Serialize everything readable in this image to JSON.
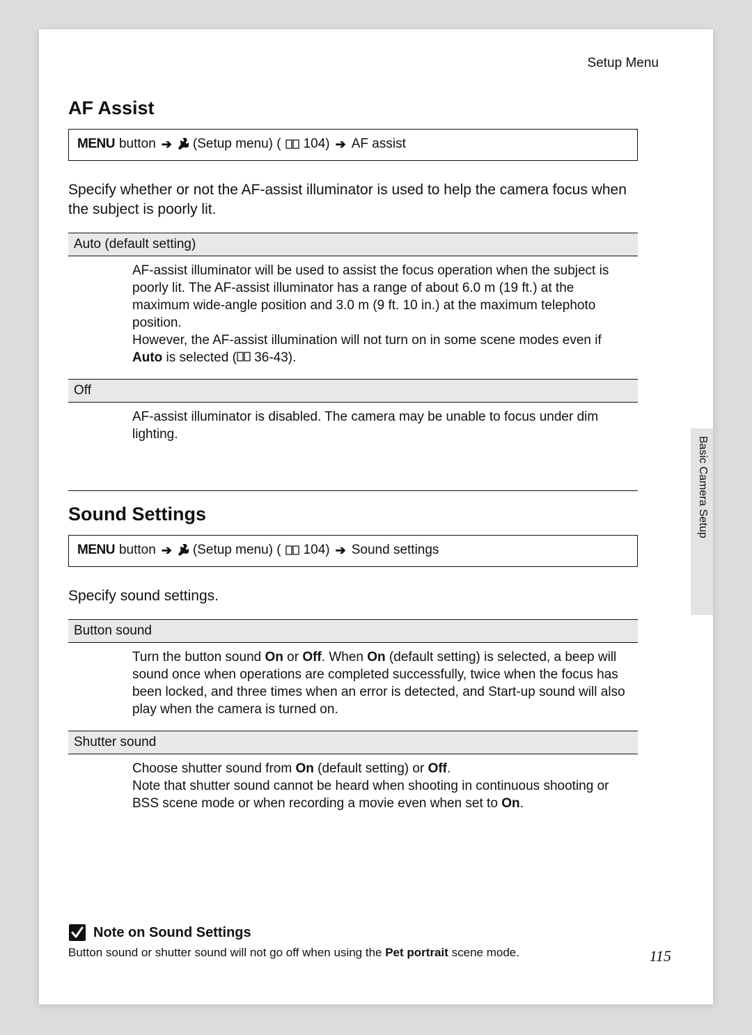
{
  "running_head": "Setup Menu",
  "side_tab_label": "Basic Camera Setup",
  "page_number": "115",
  "nav": {
    "menu_label": "MENU",
    "button_word": " button",
    "setup_menu_text": " (Setup menu) (",
    "page_ref_104": " 104)",
    "page_ref_36_43": " 36-43)."
  },
  "af": {
    "title": "AF Assist",
    "breadcrumb_end": " AF assist",
    "intro": "Specify whether or not the AF-assist illuminator is used to help the camera focus when the subject is poorly lit.",
    "opt_auto_header": "Auto (default setting)",
    "opt_auto_body_1": "AF-assist illuminator will be used to assist the focus operation when the subject is poorly lit. The AF-assist illuminator has a range of about 6.0 m (19 ft.) at the maximum wide-angle position and 3.0 m (9 ft. 10 in.) at the maximum telephoto position.",
    "opt_auto_body_2a": "However, the AF-assist illumination will not turn on in some scene modes even if ",
    "opt_auto_body_2b": "Auto",
    "opt_auto_body_2c": " is selected (",
    "opt_off_header": "Off",
    "opt_off_body": "AF-assist illuminator is disabled. The camera may be unable to focus under dim lighting."
  },
  "sound": {
    "title": "Sound Settings",
    "breadcrumb_end": " Sound settings",
    "intro": "Specify sound settings.",
    "opt_button_header": "Button sound",
    "bs_1": "Turn the button sound ",
    "bs_on": "On",
    "bs_2": " or ",
    "bs_off": "Off",
    "bs_3": ". When ",
    "bs_4": " (default setting) is selected, a beep will sound once when operations are completed successfully, twice when the focus has been locked, and three times when an error is detected, and Start-up sound will also play when the camera is turned on.",
    "opt_shutter_header": "Shutter sound",
    "sh_1": "Choose shutter sound from ",
    "sh_2": " (default setting) or ",
    "sh_3": ".",
    "sh_4": "Note that shutter sound cannot be heard when shooting in continuous shooting or BSS scene mode or when recording a movie even when set to ",
    "sh_5": "."
  },
  "note": {
    "title": "Note on Sound Settings",
    "body_1": "Button sound or shutter sound will not go off when using the ",
    "body_bold": "Pet portrait",
    "body_2": " scene mode."
  }
}
